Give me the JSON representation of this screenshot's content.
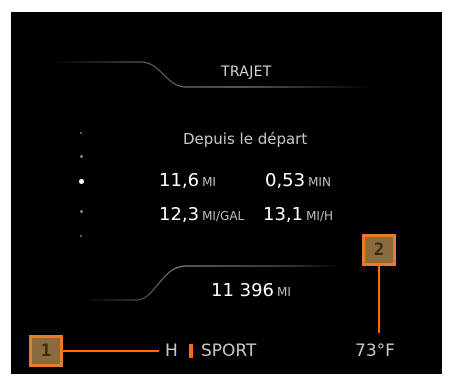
{
  "screen": {
    "title": "TRAJET",
    "subtitle": "Depuis le départ",
    "stats": {
      "distance": {
        "value": "11,6",
        "unit": "MI"
      },
      "time": {
        "value": "0,53",
        "unit": "MIN"
      },
      "consumption": {
        "value": "12,3",
        "unit": "MI/GAL"
      },
      "speed": {
        "value": "13,1",
        "unit": "MI/H"
      }
    },
    "odometer": {
      "value": "11 396",
      "unit": "MI"
    },
    "status": {
      "gear": "H",
      "mode": "SPORT",
      "temperature": "73°F"
    },
    "page_indicator": {
      "count": 5,
      "active_index": 2
    }
  },
  "callouts": [
    {
      "label": "1"
    },
    {
      "label": "2"
    }
  ],
  "colors": {
    "background": "#000000",
    "accent": "#ff6a13",
    "callout_fill": "#8b6a3e",
    "text": "#ffffff",
    "muted_text": "#c8c8c8"
  }
}
